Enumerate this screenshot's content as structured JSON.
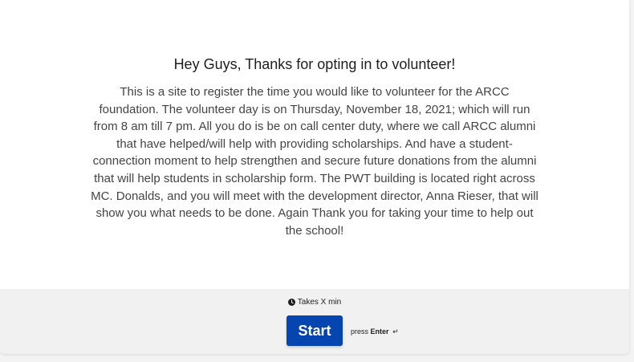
{
  "welcome": {
    "title": "Hey Guys, Thanks for opting in to volunteer!",
    "description": "This is a site to register the time you would like to volunteer for the ARCC foundation. The volunteer day is on Thursday, November 18, 2021; which will run from 8 am till 7 pm. All you do is be on call center duty, where we call ARCC alumni that have helped/will help with providing scholarships. And have a student-connection moment to help strengthen and secure future donations from the alumni that will help students in scholarship form. The PWT building is located right across MC. Donalds, and you will meet with the development director, Anna Rieser, that will show you what needs to be done. Again Thank you for taking your time to help out the school!"
  },
  "footer": {
    "time_icon": "clock-icon",
    "time_text": "Takes X min",
    "start_label": "Start",
    "press_prefix": "press",
    "press_key": "Enter",
    "enter_icon": "↵"
  },
  "colors": {
    "accent": "#0445af",
    "footer_bg": "#f1f1f1",
    "text": "#444444"
  }
}
